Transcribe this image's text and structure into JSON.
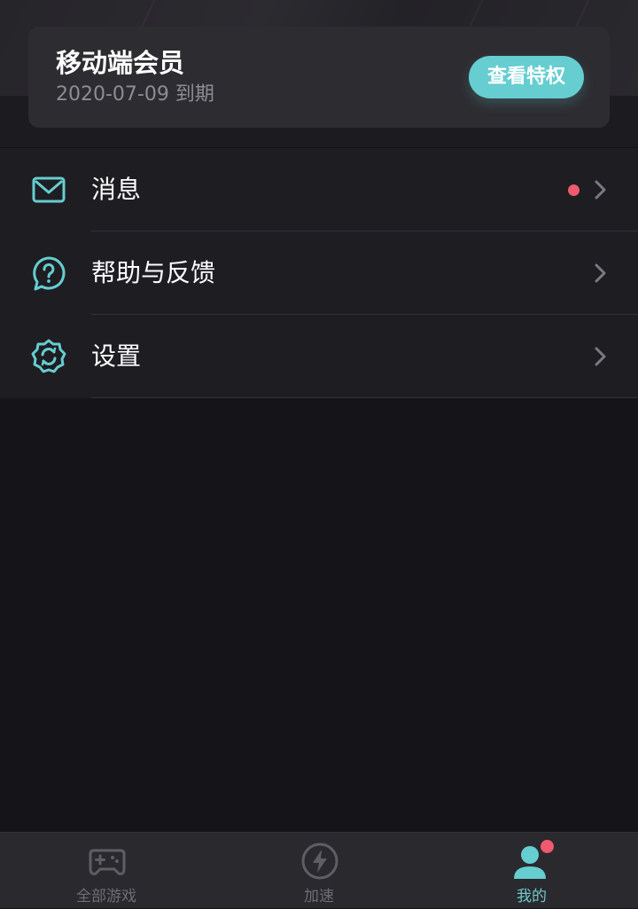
{
  "membership": {
    "title": "移动端会员",
    "expiry": "2020-07-09 到期",
    "privilege_button": "查看特权"
  },
  "menu": {
    "items": [
      {
        "label": "消息",
        "icon": "mail-icon",
        "has_unread": true
      },
      {
        "label": "帮助与反馈",
        "icon": "help-bubble-icon",
        "has_unread": false
      },
      {
        "label": "设置",
        "icon": "settings-gear-icon",
        "has_unread": false
      }
    ]
  },
  "tabbar": {
    "tabs": [
      {
        "label": "全部游戏",
        "icon": "gamepad-icon",
        "active": false
      },
      {
        "label": "加速",
        "icon": "lightning-icon",
        "active": false
      },
      {
        "label": "我的",
        "icon": "user-icon",
        "active": true,
        "badge": true
      }
    ]
  },
  "colors": {
    "accent": "#66cdd0",
    "badge": "#ef5a6e",
    "background": "#151418",
    "menu_background": "#1e1d22",
    "card_background": "#2d2c31",
    "inactive_tab": "#6e6d73"
  }
}
